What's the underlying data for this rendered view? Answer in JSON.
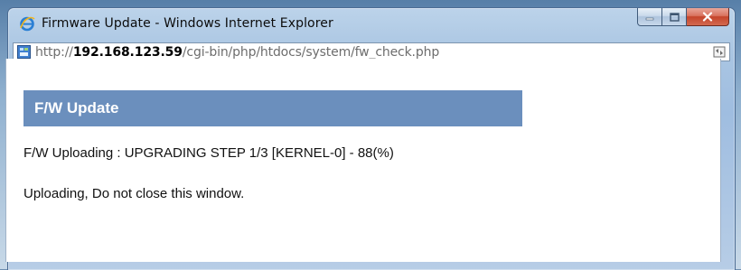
{
  "window": {
    "title": "Firmware Update - Windows Internet Explorer"
  },
  "address_bar": {
    "url_scheme": "http://",
    "url_host": "192.168.123.59",
    "url_path": "/cgi-bin/php/htdocs/system/fw_check.php"
  },
  "page": {
    "section_title": "F/W Update",
    "status_text": "F/W Uploading : UPGRADING STEP 1/3 [KERNEL-0] - 88(%)",
    "notice_text": "Uploading, Do not close this window."
  },
  "icons": {
    "browser": "internet-explorer-icon",
    "page": "page-favicon-icon",
    "compatibility": "compatibility-view-icon",
    "minimize": "minimize-icon",
    "maximize": "maximize-icon",
    "close": "close-icon"
  },
  "colors": {
    "section_header_bg": "#6b8fbd",
    "section_header_text": "#ffffff",
    "close_button": "#c5442b",
    "window_frame": "#a9c5e2"
  }
}
